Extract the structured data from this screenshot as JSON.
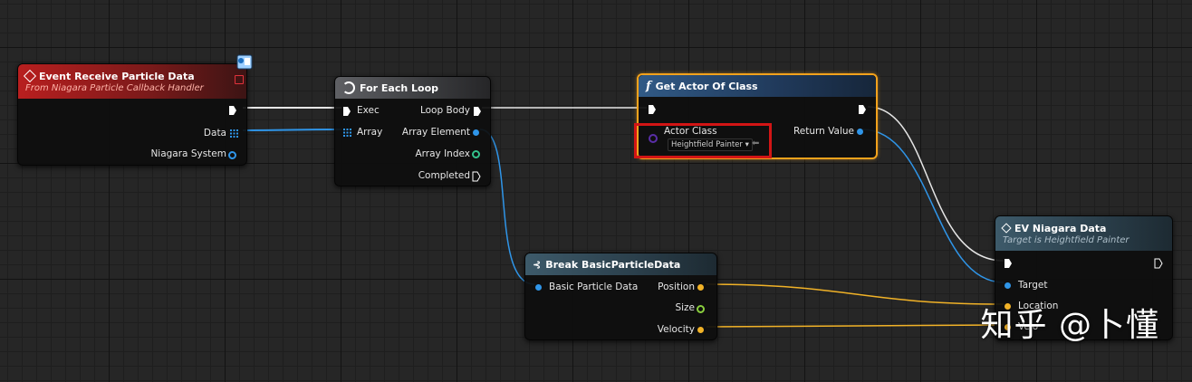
{
  "colors": {
    "exec": "#e6e6e6",
    "object_ref": "#2f95e8",
    "int": "#33c28c",
    "vector": "#f1b227",
    "struct_niagara": "#2f95e8",
    "highlight": "#d21515",
    "selected": "#f3a21c"
  },
  "nodes": {
    "event_receive": {
      "title": "Event Receive Particle Data",
      "subtitle": "From Niagara Particle Callback Handler",
      "pins": {
        "data": "Data",
        "niagara_system": "Niagara System"
      }
    },
    "for_each": {
      "title": "For Each Loop",
      "pins": {
        "exec": "Exec",
        "array": "Array",
        "loop_body": "Loop Body",
        "array_element": "Array Element",
        "array_index": "Array Index",
        "completed": "Completed"
      }
    },
    "get_actor": {
      "title": "Get Actor Of Class",
      "pins": {
        "actor_class": "Actor Class",
        "actor_class_value": "Heightfield Painter",
        "return_value": "Return Value"
      }
    },
    "break_particle": {
      "title": "Break BasicParticleData",
      "pins": {
        "input": "Basic Particle Data",
        "position": "Position",
        "size": "Size",
        "velocity": "Velocity"
      }
    },
    "ev_niagara": {
      "title": "EV Niagara Data",
      "subtitle": "Target is Heightfield Painter",
      "pins": {
        "target": "Target",
        "location": "Location",
        "velocity": "Velo"
      }
    }
  },
  "watermark": "知乎 @卜懂"
}
